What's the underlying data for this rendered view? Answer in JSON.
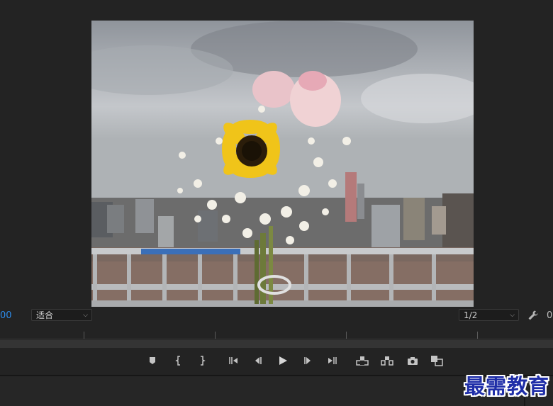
{
  "program_monitor": {
    "preview_image": "sunflower-and-roses-bouquet-city-skyline",
    "timecode": "00",
    "fit_select": {
      "value": "适合"
    },
    "resolution_select": {
      "value": "1/2"
    },
    "right_value": "0"
  },
  "transport": {
    "buttons": [
      {
        "name": "add-marker",
        "icon": "marker-icon"
      },
      {
        "name": "mark-in",
        "icon": "mark-in-icon"
      },
      {
        "name": "mark-out",
        "icon": "mark-out-icon"
      },
      {
        "name": "go-to-in",
        "icon": "go-to-in-icon"
      },
      {
        "name": "step-back",
        "icon": "step-back-icon"
      },
      {
        "name": "play",
        "icon": "play-icon"
      },
      {
        "name": "step-forward",
        "icon": "step-forward-icon"
      },
      {
        "name": "go-to-out",
        "icon": "go-to-out-icon"
      },
      {
        "name": "lift",
        "icon": "lift-icon"
      },
      {
        "name": "extract",
        "icon": "extract-icon"
      },
      {
        "name": "export-frame",
        "icon": "camera-icon"
      },
      {
        "name": "comparison-view",
        "icon": "comparison-icon"
      }
    ]
  },
  "watermark": "最需教育",
  "colors": {
    "accent": "#2d8ceb",
    "panel": "#232323",
    "watermark": "#1f2ea8"
  }
}
